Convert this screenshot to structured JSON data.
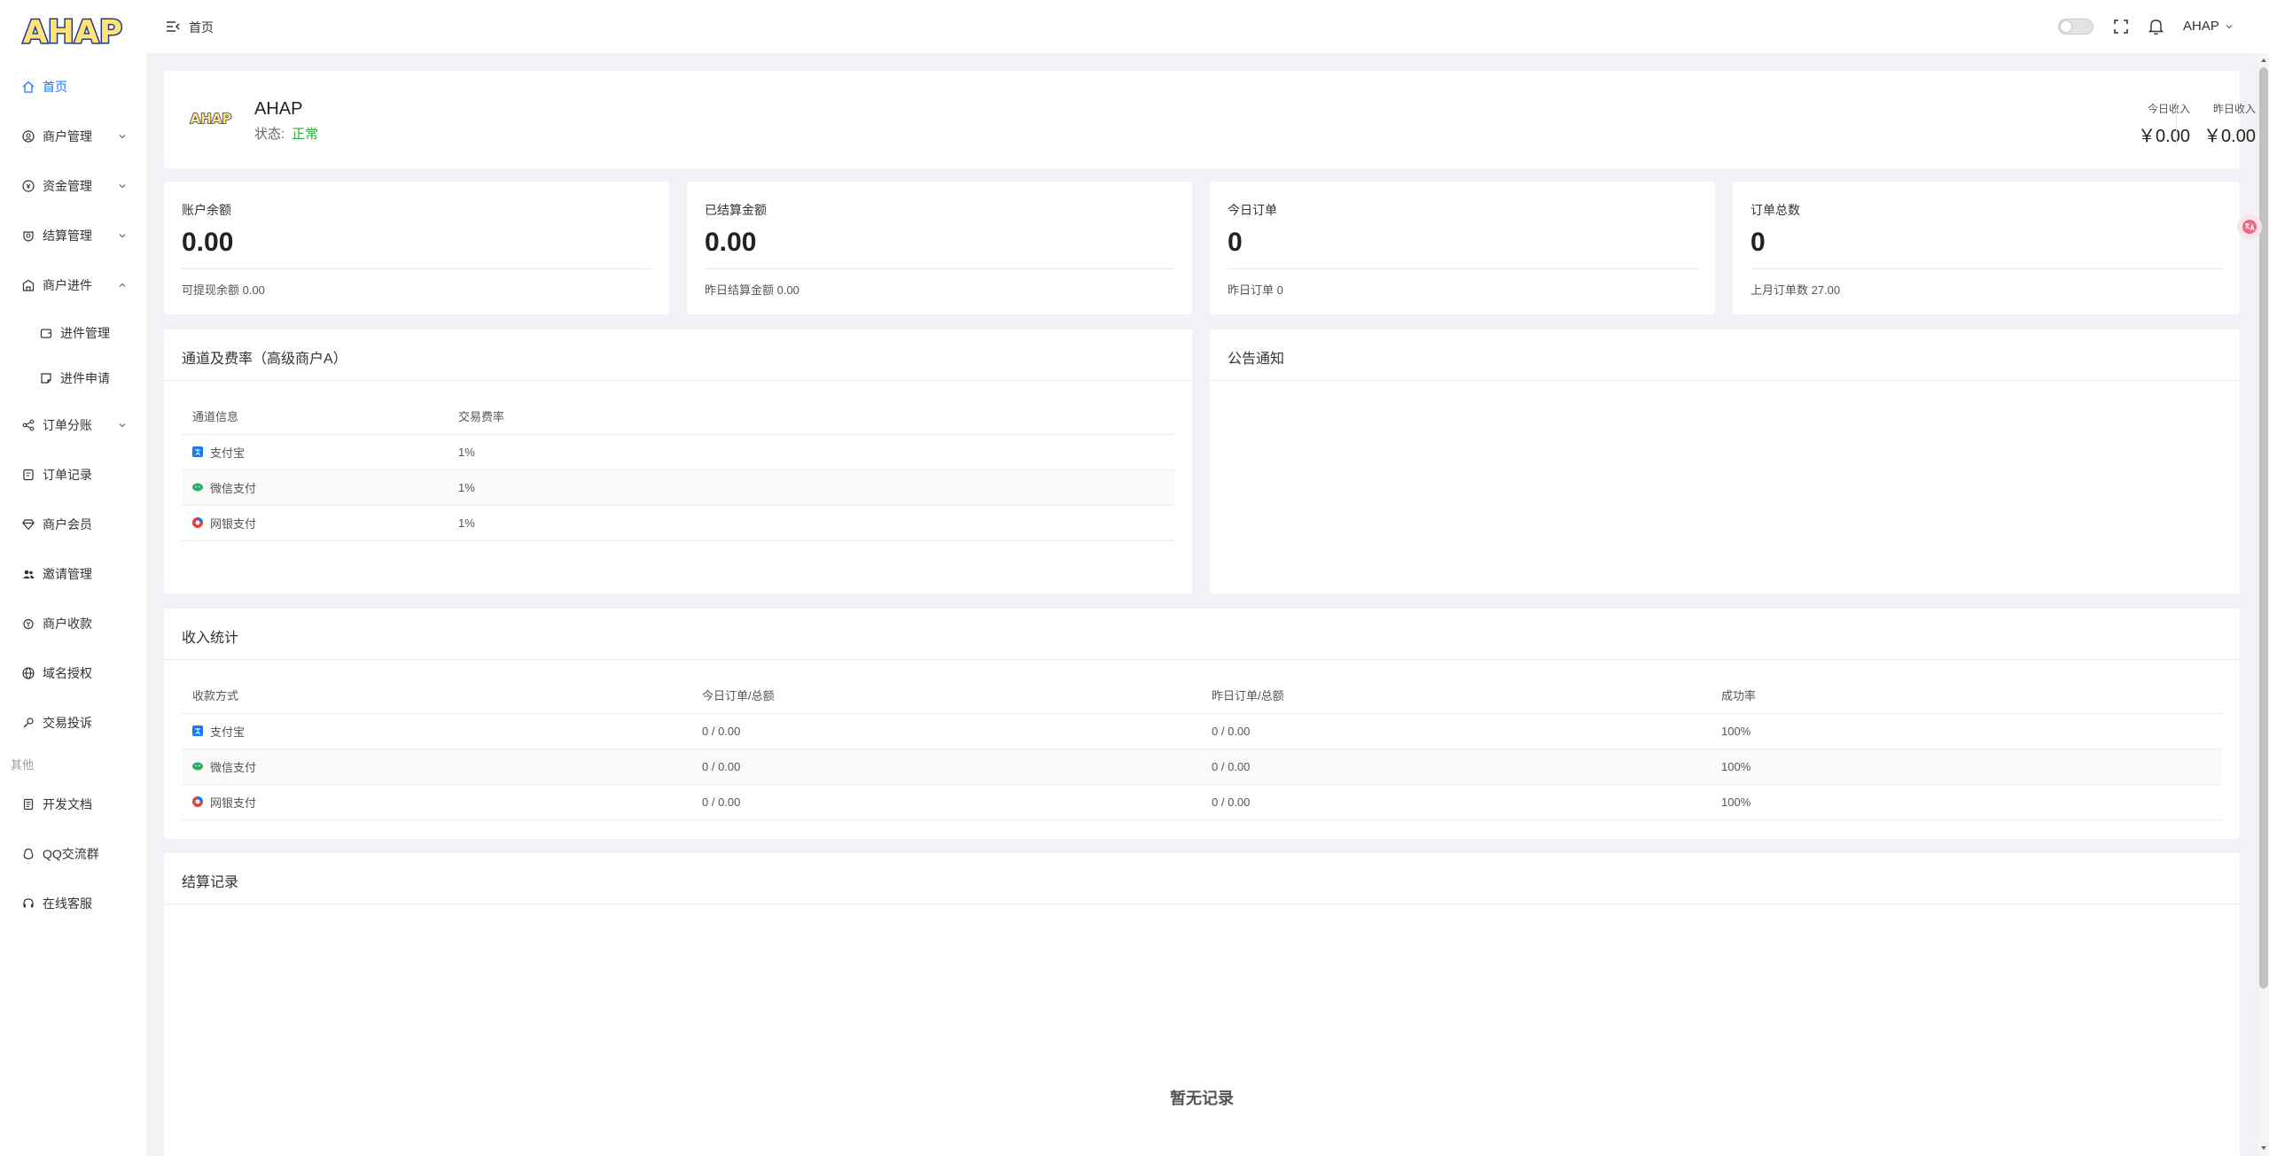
{
  "app": {
    "logo_text": "AHAP"
  },
  "sidebar": {
    "items": [
      {
        "label": "首页",
        "icon": "home-icon",
        "active": true
      },
      {
        "label": "商户管理",
        "icon": "user-circle-icon",
        "caret": "down"
      },
      {
        "label": "资金管理",
        "icon": "money-icon",
        "caret": "down"
      },
      {
        "label": "结算管理",
        "icon": "settle-icon",
        "caret": "down"
      },
      {
        "label": "商户进件",
        "icon": "store-icon",
        "caret": "up"
      },
      {
        "label": "进件管理",
        "icon": "wallet-icon",
        "sub": true
      },
      {
        "label": "进件申请",
        "icon": "form-icon",
        "sub": true
      },
      {
        "label": "订单分账",
        "icon": "share-icon",
        "caret": "down"
      },
      {
        "label": "订单记录",
        "icon": "order-icon"
      },
      {
        "label": "商户会员",
        "icon": "diamond-icon"
      },
      {
        "label": "邀请管理",
        "icon": "users-icon"
      },
      {
        "label": "商户收款",
        "icon": "collect-icon"
      },
      {
        "label": "域名授权",
        "icon": "globe-icon"
      },
      {
        "label": "交易投诉",
        "icon": "complaint-icon"
      }
    ],
    "group_label": "其他",
    "other_items": [
      {
        "label": "开发文档",
        "icon": "doc-icon"
      },
      {
        "label": "QQ交流群",
        "icon": "qq-icon"
      },
      {
        "label": "在线客服",
        "icon": "headset-icon"
      }
    ]
  },
  "header": {
    "breadcrumb": "首页",
    "user": "AHAP"
  },
  "profile": {
    "name": "AHAP",
    "status_label": "状态:",
    "status_value": "正常",
    "today_income_label": "今日收入",
    "today_income": "￥0.00",
    "yesterday_income_label": "昨日收入",
    "yesterday_income": "￥0.00"
  },
  "stats": [
    {
      "label": "账户余额",
      "value": "0.00",
      "sub": "可提现余额 0.00"
    },
    {
      "label": "已结算金额",
      "value": "0.00",
      "sub": "昨日结算金额 0.00"
    },
    {
      "label": "今日订单",
      "value": "0",
      "sub": "昨日订单 0"
    },
    {
      "label": "订单总数",
      "value": "0",
      "sub": "上月订单数 27.00"
    }
  ],
  "channels": {
    "title": "通道及费率（高级商户A）",
    "headers": [
      "通道信息",
      "交易费率"
    ],
    "rows": [
      {
        "name": "支付宝",
        "rate": "1%",
        "icon": "alipay-icon"
      },
      {
        "name": "微信支付",
        "rate": "1%",
        "icon": "wechat-icon"
      },
      {
        "name": "网银支付",
        "rate": "1%",
        "icon": "bank-icon"
      }
    ]
  },
  "notice": {
    "title": "公告通知"
  },
  "income": {
    "title": "收入统计",
    "headers": [
      "收款方式",
      "今日订单/总额",
      "昨日订单/总额",
      "成功率"
    ],
    "rows": [
      {
        "name": "支付宝",
        "today": "0 / 0.00",
        "yesterday": "0 / 0.00",
        "rate": "100%",
        "icon": "alipay-icon"
      },
      {
        "name": "微信支付",
        "today": "0 / 0.00",
        "yesterday": "0 / 0.00",
        "rate": "100%",
        "icon": "wechat-icon"
      },
      {
        "name": "网银支付",
        "today": "0 / 0.00",
        "yesterday": "0 / 0.00",
        "rate": "100%",
        "icon": "bank-icon"
      }
    ]
  },
  "settlement": {
    "title": "结算记录",
    "empty": "暂无记录"
  },
  "colors": {
    "accent": "#1677ff",
    "status_ok": "#2eaa3a",
    "alipay": "#1677ff",
    "wechat": "#2aae67",
    "bank": "#e8403a"
  }
}
